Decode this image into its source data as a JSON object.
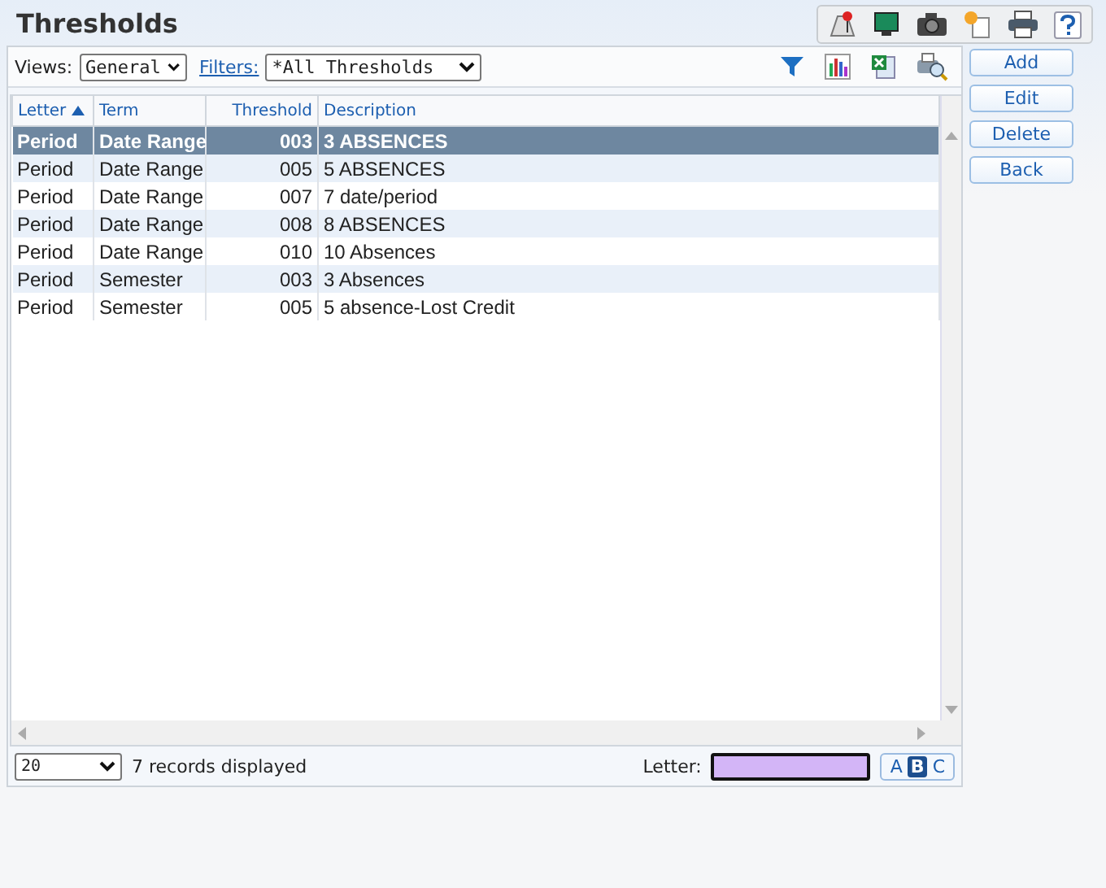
{
  "title": "Thresholds",
  "toolbar": {
    "views_label": "Views:",
    "view": "General",
    "filters_label": "Filters:",
    "filter": "*All Thresholds"
  },
  "columns": [
    {
      "label": "Letter",
      "sorted": true,
      "kind": "text"
    },
    {
      "label": "Term",
      "sorted": false,
      "kind": "text"
    },
    {
      "label": "Threshold",
      "sorted": false,
      "kind": "number"
    },
    {
      "label": "Description",
      "sorted": false,
      "kind": "text"
    }
  ],
  "rows": [
    {
      "cells": [
        "Period",
        "Date Range",
        "003",
        "3 ABSENCES"
      ],
      "selected": true
    },
    {
      "cells": [
        "Period",
        "Date Range",
        "005",
        "5 ABSENCES"
      ],
      "selected": false
    },
    {
      "cells": [
        "Period",
        "Date Range",
        "007",
        "7 date/period"
      ],
      "selected": false
    },
    {
      "cells": [
        "Period",
        "Date Range",
        "008",
        "8 ABSENCES"
      ],
      "selected": false
    },
    {
      "cells": [
        "Period",
        "Date Range",
        "010",
        "10 Absences"
      ],
      "selected": false
    },
    {
      "cells": [
        "Period",
        "Semester",
        "003",
        "3 Absences"
      ],
      "selected": false
    },
    {
      "cells": [
        "Period",
        "Semester",
        "005",
        "5 absence-Lost Credit"
      ],
      "selected": false
    }
  ],
  "footer": {
    "page_size": "20",
    "records": "7 records displayed",
    "letter_label": "Letter:",
    "letter_modes": [
      {
        "label": "A",
        "selected": false
      },
      {
        "label": "B",
        "selected": true
      },
      {
        "label": "C",
        "selected": false
      }
    ]
  },
  "buttons": [
    "Add",
    "Edit",
    "Delete",
    "Back"
  ]
}
